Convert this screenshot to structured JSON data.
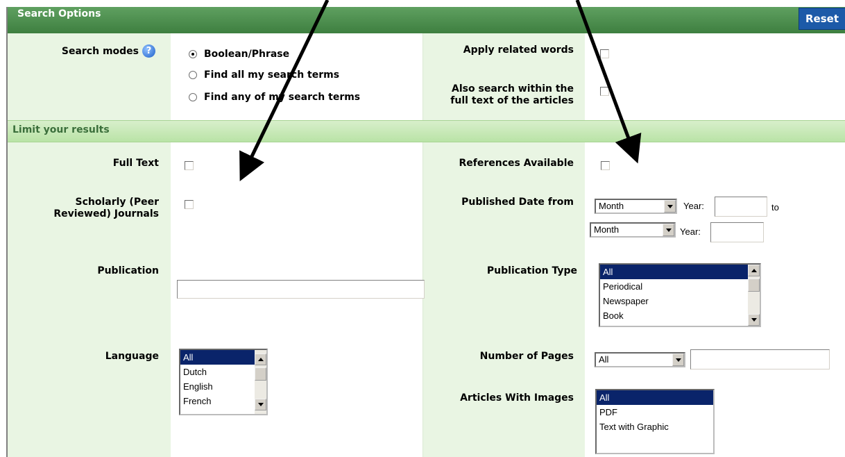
{
  "header": {
    "title": "Search Options",
    "reset_label": "Reset"
  },
  "search_modes": {
    "label": "Search modes",
    "help_glyph": "?",
    "options": [
      "Boolean/Phrase",
      "Find all my search terms",
      "Find any of my search terms"
    ],
    "selected": "Boolean/Phrase"
  },
  "apply_related_words": {
    "label": "Apply related words"
  },
  "full_text_search": {
    "label_line1": "Also search within the",
    "label_line2": "full text of the articles"
  },
  "limit": {
    "title": "Limit your results",
    "full_text": {
      "label": "Full Text"
    },
    "references": {
      "label": "References Available"
    },
    "scholarly": {
      "label_line1": "Scholarly (Peer",
      "label_line2": "Reviewed) Journals"
    },
    "published_date": {
      "label": "Published Date from",
      "month_from": "Month",
      "year_label": "Year:",
      "to_label": "to",
      "month_to": "Month",
      "year_label_2": "Year:"
    },
    "publication": {
      "label": "Publication",
      "value": ""
    },
    "publication_type": {
      "label": "Publication Type",
      "options": [
        "All",
        "Periodical",
        "Newspaper",
        "Book"
      ],
      "selected": "All"
    },
    "language": {
      "label": "Language",
      "options": [
        "All",
        "Dutch",
        "English",
        "French"
      ],
      "selected": "All"
    },
    "number_of_pages": {
      "label": "Number of Pages",
      "selected": "All",
      "value": ""
    },
    "articles_with_images": {
      "label": "Articles With Images",
      "options": [
        "All",
        "PDF",
        "Text with Graphic"
      ],
      "selected": "All"
    }
  },
  "colors": {
    "header_green": "#4a8c4b",
    "band_green": "#c6e8b5",
    "label_bg": "#e9f5e3",
    "reset_blue": "#1c5aa8",
    "selection": "#0a246a"
  }
}
